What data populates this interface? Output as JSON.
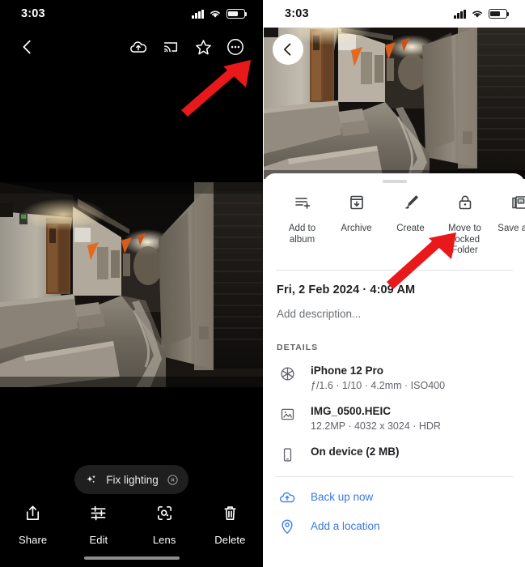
{
  "left_screen": {
    "status": {
      "time": "3:03",
      "signal_icon": "cellular-bars-icon",
      "wifi_icon": "wifi-icon",
      "battery_icon": "battery-icon"
    },
    "toolbar": {
      "back_icon": "back-chevron-icon",
      "items": [
        {
          "icon": "cloud-backup-icon",
          "name": "backup-status-button"
        },
        {
          "icon": "cast-icon",
          "name": "cast-button"
        },
        {
          "icon": "star-icon",
          "name": "favorite-button"
        },
        {
          "icon": "more-options-icon",
          "name": "more-options-button"
        }
      ]
    },
    "chip": {
      "label": "Fix lighting",
      "leading_icon": "sparkle-icon",
      "dismiss_icon": "close-circle-icon"
    },
    "bottom_actions": [
      {
        "label": "Share",
        "icon": "share-icon"
      },
      {
        "label": "Edit",
        "icon": "edit-sliders-icon"
      },
      {
        "label": "Lens",
        "icon": "lens-icon"
      },
      {
        "label": "Delete",
        "icon": "trash-icon"
      }
    ],
    "photo": {
      "alt": "night-alleyway-photo"
    }
  },
  "right_screen": {
    "status": {
      "time": "3:03",
      "signal_icon": "cellular-bars-icon",
      "wifi_icon": "wifi-icon",
      "battery_icon": "battery-icon"
    },
    "back_button": {
      "icon": "back-chevron-icon"
    },
    "photo": {
      "alt": "night-alleyway-photo"
    },
    "sheet": {
      "actions": [
        {
          "label": "Add to\nalbum",
          "icon": "add-to-album-icon"
        },
        {
          "label": "Archive",
          "icon": "archive-icon"
        },
        {
          "label": "Create",
          "icon": "create-brush-icon"
        },
        {
          "label": "Move to\nLocked\nFolder",
          "icon": "lock-icon"
        },
        {
          "label": "Save as P",
          "icon": "save-as-pdf-icon"
        }
      ],
      "datetime": "Fri, 2 Feb 2024  ·  4:09 AM",
      "description_placeholder": "Add description...",
      "details_header": "DETAILS",
      "details": [
        {
          "icon": "camera-aperture-icon",
          "title": "iPhone 12 Pro",
          "subtitle": "ƒ/1.6  ·  1/10  ·  4.2mm  ·  ISO400"
        },
        {
          "icon": "image-icon",
          "title": "IMG_0500.HEIC",
          "subtitle": "12.2MP  ·  4032 x 3024  ·  HDR"
        },
        {
          "icon": "phone-icon",
          "title": "On device (2 MB)",
          "subtitle": ""
        }
      ],
      "links": [
        {
          "label": "Back up now",
          "icon": "cloud-upload-icon"
        },
        {
          "label": "Add a location",
          "icon": "location-pin-icon"
        }
      ]
    }
  },
  "annotations": {
    "arrow_color": "#e8181b",
    "arrows": [
      {
        "name": "arrow-to-more-options",
        "target": "more-options-button"
      },
      {
        "name": "arrow-to-move-to-locked-folder",
        "target": "move-to-locked-folder-action"
      }
    ]
  }
}
